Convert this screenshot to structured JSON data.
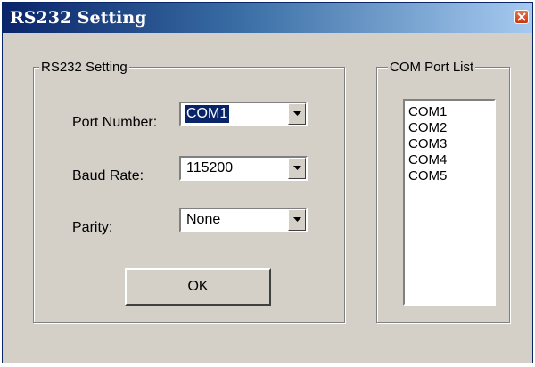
{
  "window": {
    "title": "RS232 Setting"
  },
  "settings_group": {
    "legend": "RS232 Setting",
    "port_number": {
      "label": "Port Number:",
      "value": "COM1"
    },
    "baud_rate": {
      "label": "Baud Rate:",
      "value": "115200"
    },
    "parity": {
      "label": "Parity:",
      "value": "None"
    },
    "ok_label": "OK"
  },
  "com_port_group": {
    "legend": "COM Port List",
    "items": [
      "COM1",
      "COM2",
      "COM3",
      "COM4",
      "COM5"
    ]
  },
  "icons": {
    "close": "close-icon",
    "dropdown": "chevron-down-icon"
  },
  "colors": {
    "titlebar_start": "#0a246a",
    "titlebar_end": "#a6caf0",
    "face": "#d4d0c8",
    "selection": "#0a246a",
    "close_button": "#c9380f"
  }
}
